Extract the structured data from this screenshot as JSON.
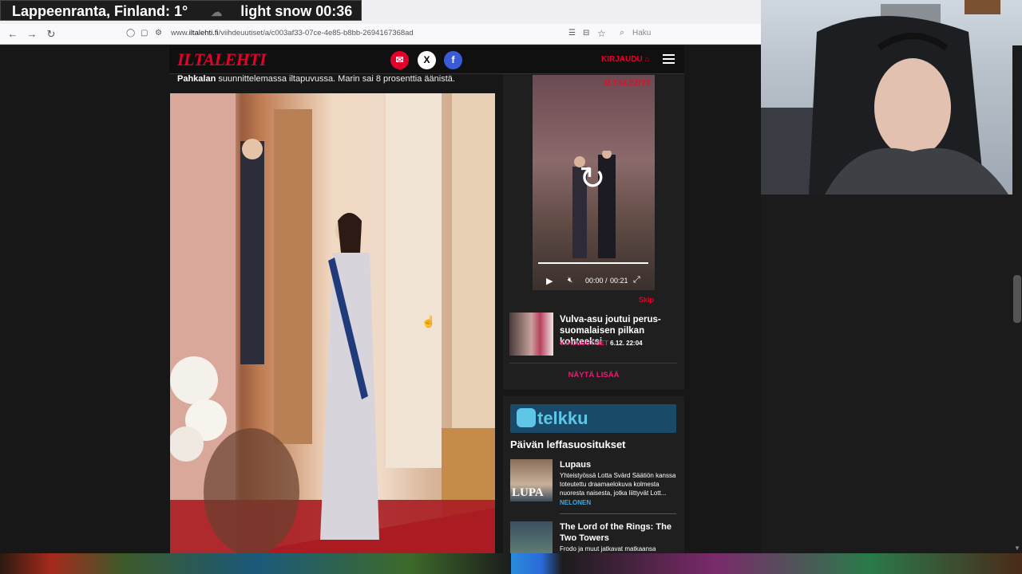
{
  "overlay": {
    "location": "Lappeenranta, Finland: 1°",
    "weather": "light snow 00:36"
  },
  "browser": {
    "url_domain": "iltalehti.fi",
    "url_path": "/viihdeuutiset/a/c003af33-07ce-4e85-b8bb-2694167368ad",
    "search_placeholder": "Haku"
  },
  "site": {
    "logo": "ILTALEHTI",
    "login": "KIRJAUDU"
  },
  "article": {
    "caption_bold": "Pahkalan",
    "caption_rest": " suunnittelemassa iltapuvussa. Marin sai 8 prosenttia äänistä."
  },
  "video": {
    "logo": "ILTALEHTI",
    "time_current": "00:00",
    "time_sep": "/",
    "time_total": "00:21",
    "skip": "Skip"
  },
  "related": {
    "title": "Vulva-asu joutui perus-suomalaisen pilkan kohteeksi",
    "category": "VIIHDEUUTISET",
    "date": "6.12. 22:04",
    "show_more": "NÄYTÄ LISÄÄ"
  },
  "telkku": {
    "logo": "telkku",
    "heading": "Päivän leffasuositukset",
    "movies": [
      {
        "title": "Lupaus",
        "desc": "Yhteistyössä Lotta Svärd Säätiön kanssa toteutettu draamaelokuva kolmesta nuoresta naisesta, jotka liittyvät Lott...",
        "channel": "NELONEN",
        "thumb_text": "LUPA"
      },
      {
        "title": "The Lord of the Rings: The Two Towers",
        "desc": "Frodo ja muut jatkavat matkaansa"
      }
    ]
  }
}
